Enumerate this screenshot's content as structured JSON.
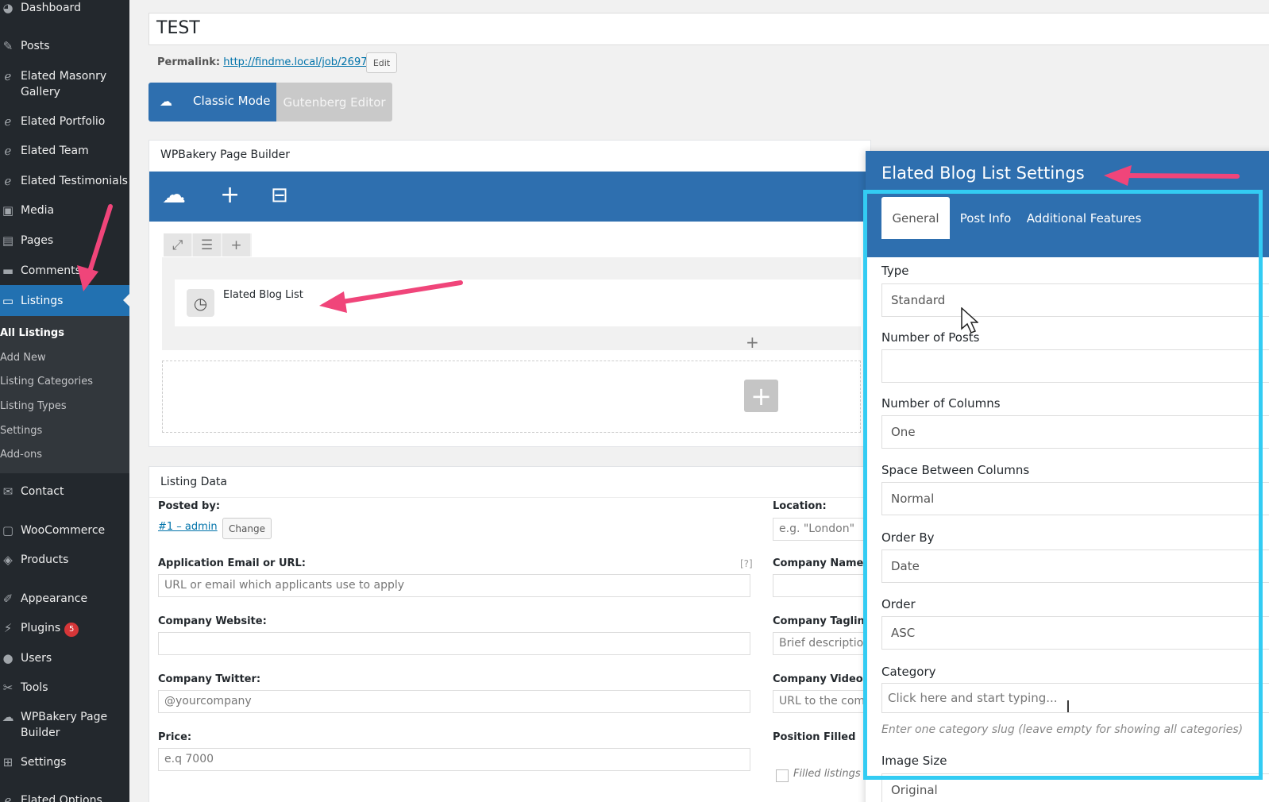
{
  "sidebar": {
    "items": [
      {
        "label": "Dashboard",
        "icon": "dashboard-icon"
      },
      {
        "label": "Posts",
        "icon": "pin-icon"
      },
      {
        "label": "Elated Masonry Gallery",
        "icon": "elated-icon"
      },
      {
        "label": "Elated Portfolio",
        "icon": "elated-icon"
      },
      {
        "label": "Elated Team",
        "icon": "elated-icon"
      },
      {
        "label": "Elated Testimonials",
        "icon": "elated-icon"
      },
      {
        "label": "Media",
        "icon": "media-icon"
      },
      {
        "label": "Pages",
        "icon": "pages-icon"
      },
      {
        "label": "Comments",
        "icon": "comments-icon"
      },
      {
        "label": "Listings",
        "icon": "briefcase-icon"
      },
      {
        "label": "Contact",
        "icon": "mail-icon"
      },
      {
        "label": "WooCommerce",
        "icon": "woo-icon"
      },
      {
        "label": "Products",
        "icon": "products-icon"
      },
      {
        "label": "Appearance",
        "icon": "brush-icon"
      },
      {
        "label": "Plugins",
        "icon": "plugin-icon"
      },
      {
        "label": "Users",
        "icon": "users-icon"
      },
      {
        "label": "Tools",
        "icon": "wrench-icon"
      },
      {
        "label": "WPBakery Page Builder",
        "icon": "wpbakery-icon"
      },
      {
        "label": "Settings",
        "icon": "settings-icon"
      },
      {
        "label": "Elated Options",
        "icon": "elated-icon"
      }
    ],
    "plugins_badge": "5",
    "submenu": [
      "All Listings",
      "Add New",
      "Listing Categories",
      "Listing Types",
      "Settings",
      "Add-ons"
    ]
  },
  "editor": {
    "title": "TEST",
    "permalink_label": "Permalink:",
    "permalink_url": "http://findme.local/job/2697/",
    "edit_label": "Edit",
    "classic_mode": "Classic Mode",
    "gutenberg_editor": "Gutenberg Editor"
  },
  "wpbakery": {
    "title": "WPBakery Page Builder",
    "element_label": "Elated Blog List"
  },
  "listing": {
    "title": "Listing Data",
    "posted_by_label": "Posted by:",
    "posted_by_value": "#1 – admin",
    "change_label": "Change",
    "app_email_label": "Application Email or URL:",
    "app_email_placeholder": "URL or email which applicants use to apply",
    "help_mark": "[?]",
    "website_label": "Company Website:",
    "twitter_label": "Company Twitter:",
    "twitter_placeholder": "@yourcompany",
    "price_label": "Price:",
    "price_placeholder": "e.q 7000",
    "location_label": "Location:",
    "location_placeholder": "e.g. \"London\"",
    "company_name_label": "Company Name:",
    "tagline_label": "Company Tagline",
    "tagline_placeholder": "Brief description",
    "video_label": "Company Video:",
    "video_placeholder": "URL to the comp",
    "position_filled_label": "Position Filled",
    "filled_text": "Filled listings w"
  },
  "modal": {
    "title": "Elated Blog List Settings",
    "tabs": [
      "General",
      "Post Info",
      "Additional Features"
    ],
    "fields": {
      "type_label": "Type",
      "type_value": "Standard",
      "num_posts_label": "Number of Posts",
      "num_posts_value": "",
      "num_cols_label": "Number of Columns",
      "num_cols_value": "One",
      "space_label": "Space Between Columns",
      "space_value": "Normal",
      "orderby_label": "Order By",
      "orderby_value": "Date",
      "order_label": "Order",
      "order_value": "ASC",
      "category_label": "Category",
      "category_placeholder": "Click here and start typing...",
      "category_hint": "Enter one category slug (leave empty for showing all categories)",
      "image_size_label": "Image Size",
      "image_size_value": "Original"
    }
  },
  "colors": {
    "accent": "#2e6faf",
    "highlight": "#33ccf3",
    "arrow": "#f0457a",
    "sidebar": "#23282d"
  }
}
